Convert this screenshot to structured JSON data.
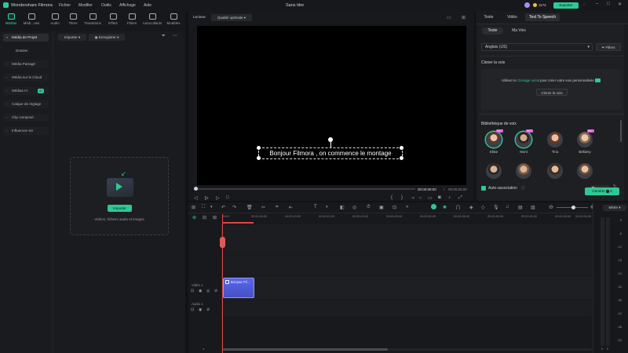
{
  "app": {
    "name": "Wondershare Filmora",
    "document_title": "Sans titre",
    "export_label": "Exporter",
    "credits": "1174"
  },
  "menu": [
    "Fichier",
    "Modifier",
    "Outils",
    "Affichage",
    "Aide"
  ],
  "toolbar": [
    "Médias",
    "Médi...ues",
    "Audio",
    "Titres",
    "Transitions",
    "Effets",
    "Filtres",
    "Autocollants",
    "Modèles"
  ],
  "media": {
    "import_label": "Importer",
    "record_label": "Enregistrer",
    "sidebar": [
      "Média de Projet",
      "Dossier",
      "Média Partagé",
      "Média sur le Cloud",
      "Médias IA",
      "Calque de réglage",
      "Clip composé",
      "Influencer Kit"
    ],
    "ai_badge": "AI",
    "drop_button": "Importer",
    "drop_hint": "Vidéos, fichiers audio et images"
  },
  "player": {
    "label": "Lecteur",
    "quality": "Qualité optimale",
    "caption": "Bonjour Filmora , on commence le montage",
    "time_current": "00:00:00:00",
    "time_separator": "/",
    "time_total": "00:00:05:00"
  },
  "right_panel": {
    "tabs": [
      "Texte",
      "Vidéo",
      "Text To Speech"
    ],
    "subtabs": [
      "Texte",
      "Ma Voix"
    ],
    "language": "Anglais (US)",
    "filters_label": "Filtres",
    "clone_title": "Cloner la voix",
    "clone_text_before": "Utilisez le",
    "clone_link": "Clonage vocal",
    "clone_text_after": "pour créer votre voix personnalisée",
    "clone_button": "Cloner la voix",
    "library_title": "Bibliothèque de voix",
    "voices": [
      "Ellise",
      "Mont",
      "Tina",
      "Bellamy",
      "",
      "",
      "",
      ""
    ],
    "hot_badge": "HOT",
    "auto_match": "Auto-association",
    "credit_value": "1374",
    "generate_label": "Générer",
    "generate_cost": "5"
  },
  "timeline": {
    "ticks": [
      "00:00",
      "00:00:05:00",
      "00:00:10:00",
      "00:00:15:00",
      "00:00:20:00",
      "00:00:25:00",
      "00:00:30:00",
      "00:00:35:00",
      "00:00:40:00",
      "00:00:45:00",
      "00:00:50:00",
      "00:00:55:00"
    ],
    "video_track": "Vidéo 1",
    "audio_track": "Audio 1",
    "clip_label": "Bonjour Fil...",
    "meter_label": "Mètre",
    "meter_scale": [
      "0",
      "-6",
      "-12",
      "-18",
      "-24",
      "-30",
      "-36",
      "-42",
      "-48",
      "-54"
    ],
    "meter_bottom": [
      "0",
      "0"
    ]
  }
}
